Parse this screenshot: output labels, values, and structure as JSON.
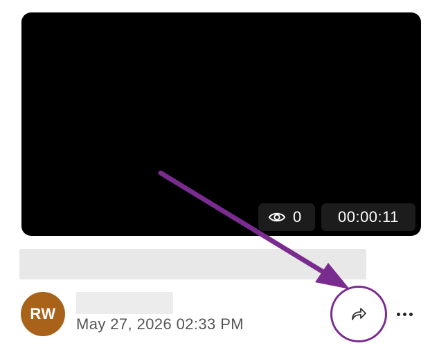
{
  "video": {
    "views_count": "0",
    "duration": "00:00:11",
    "icons": {
      "views": "eye-icon"
    }
  },
  "author": {
    "initials": "RW",
    "avatar_color": "#a8621a",
    "date": "May 27, 2026 02:33 PM"
  },
  "actions": {
    "share_icon": "share-forward-icon",
    "more_icon": "more-horizontal-icon"
  },
  "annotation": {
    "color": "#7a2b8f"
  }
}
